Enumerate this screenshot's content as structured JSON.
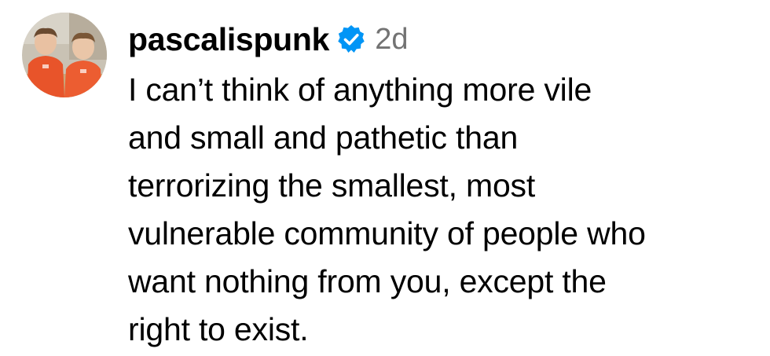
{
  "comment": {
    "username": "pascalispunk",
    "verified": true,
    "timestamp": "2d",
    "text": "I can’t think of anything more vile\nand small and pathetic than\nterrorizing the smallest, most\nvulnerable community of people who\nwant nothing from you, except the\nright to exist."
  },
  "colors": {
    "verified_badge": "#0095f6",
    "timestamp": "#737373",
    "text": "#000000",
    "avatar_shirt": "#e8542a",
    "avatar_background": "#c9c2b4"
  },
  "icons": {
    "avatar": "profile-photo",
    "verified": "verified-badge-icon"
  }
}
